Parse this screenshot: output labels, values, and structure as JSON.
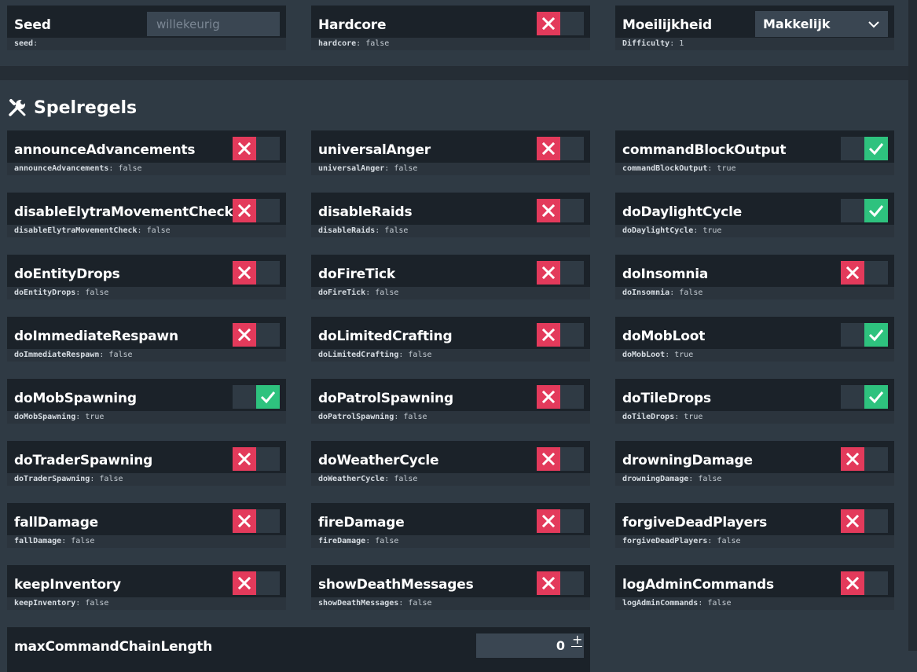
{
  "top": {
    "seed": {
      "label": "Seed",
      "placeholder": "willekeurig",
      "value": "",
      "key": "seed",
      "sep": ":",
      "footval": ""
    },
    "hardcore": {
      "label": "Hardcore",
      "key": "hardcore",
      "sep": ":",
      "footval": " false"
    },
    "difficulty": {
      "label": "Moeilijkheid",
      "selected": "Makkelijk",
      "key": "Difficulty",
      "sep": ":",
      "footval": " 1"
    }
  },
  "gamerules": {
    "title": "Spelregels",
    "rules": [
      {
        "label": "announceAdvancements",
        "key": "announceAdvancements",
        "sep": ":",
        "footval": " false",
        "on": false
      },
      {
        "label": "universalAnger",
        "key": "universalAnger",
        "sep": ":",
        "footval": " false",
        "on": false
      },
      {
        "label": "commandBlockOutput",
        "key": "commandBlockOutput",
        "sep": ":",
        "footval": " true",
        "on": true
      },
      {
        "label": "disableElytraMovementCheck",
        "key": "disableElytraMovementCheck",
        "sep": ":",
        "footval": " false",
        "on": false
      },
      {
        "label": "disableRaids",
        "key": "disableRaids",
        "sep": ":",
        "footval": " false",
        "on": false
      },
      {
        "label": "doDaylightCycle",
        "key": "doDaylightCycle",
        "sep": ":",
        "footval": " true",
        "on": true
      },
      {
        "label": "doEntityDrops",
        "key": "doEntityDrops",
        "sep": ":",
        "footval": " false",
        "on": false
      },
      {
        "label": "doFireTick",
        "key": "doFireTick",
        "sep": ":",
        "footval": " false",
        "on": false
      },
      {
        "label": "doInsomnia",
        "key": "doInsomnia",
        "sep": ":",
        "footval": " false",
        "on": false
      },
      {
        "label": "doImmediateRespawn",
        "key": "doImmediateRespawn",
        "sep": ":",
        "footval": " false",
        "on": false
      },
      {
        "label": "doLimitedCrafting",
        "key": "doLimitedCrafting",
        "sep": ":",
        "footval": " false",
        "on": false
      },
      {
        "label": "doMobLoot",
        "key": "doMobLoot",
        "sep": ":",
        "footval": " true",
        "on": true
      },
      {
        "label": "doMobSpawning",
        "key": "doMobSpawning",
        "sep": ":",
        "footval": " true",
        "on": true
      },
      {
        "label": "doPatrolSpawning",
        "key": "doPatrolSpawning",
        "sep": ":",
        "footval": " false",
        "on": false
      },
      {
        "label": "doTileDrops",
        "key": "doTileDrops",
        "sep": ":",
        "footval": " true",
        "on": true
      },
      {
        "label": "doTraderSpawning",
        "key": "doTraderSpawning",
        "sep": ":",
        "footval": " false",
        "on": false
      },
      {
        "label": "doWeatherCycle",
        "key": "doWeatherCycle",
        "sep": ":",
        "footval": " false",
        "on": false
      },
      {
        "label": "drowningDamage",
        "key": "drowningDamage",
        "sep": ":",
        "footval": " false",
        "on": false
      },
      {
        "label": "fallDamage",
        "key": "fallDamage",
        "sep": ":",
        "footval": " false",
        "on": false
      },
      {
        "label": "fireDamage",
        "key": "fireDamage",
        "sep": ":",
        "footval": " false",
        "on": false
      },
      {
        "label": "forgiveDeadPlayers",
        "key": "forgiveDeadPlayers",
        "sep": ":",
        "footval": " false",
        "on": false
      },
      {
        "label": "keepInventory",
        "key": "keepInventory",
        "sep": ":",
        "footval": " false",
        "on": false
      },
      {
        "label": "showDeathMessages",
        "key": "showDeathMessages",
        "sep": ":",
        "footval": " false",
        "on": false
      },
      {
        "label": "logAdminCommands",
        "key": "logAdminCommands",
        "sep": ":",
        "footval": " false",
        "on": false
      }
    ],
    "maxCommandChainLength": {
      "label": "maxCommandChainLength",
      "value": "0",
      "stepper": "+"
    }
  },
  "icons": {
    "section": "wrench-screwdriver-icon",
    "on": "check-icon",
    "off": "x-icon",
    "select": "chevron-down-icon"
  },
  "colors": {
    "off": "#e33a5b",
    "on": "#2ec27e",
    "card": "#1b2229",
    "page": "#2f3a44"
  }
}
